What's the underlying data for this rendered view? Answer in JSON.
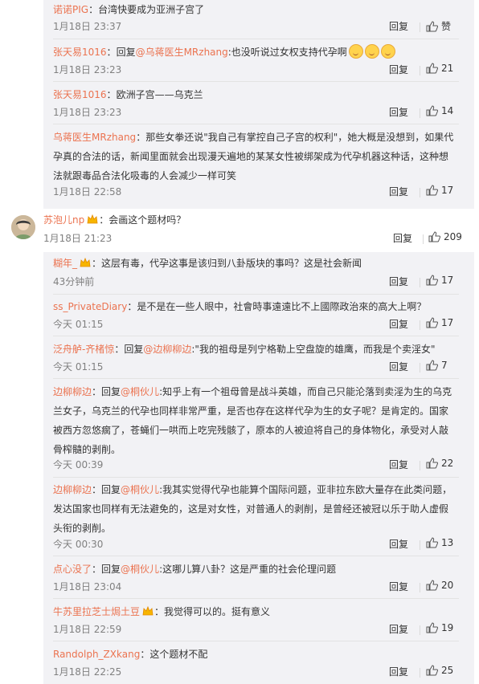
{
  "reply_label": "回复",
  "reply_to_prefix": "回复",
  "colon": ":",
  "comments_upper": [
    {
      "user": "诺诺PIG",
      "sep": "：",
      "text": "台湾快要成为亚洲子宫了",
      "time": "1月18日 23:37",
      "likes": "赞"
    },
    {
      "user": "张天易1016",
      "mention": "@乌蒋医生MRzhang",
      "text": ":也没听说过女权支持代孕啊",
      "time": "1月18日 23:23",
      "likes": "21"
    },
    {
      "user": "张天易1016",
      "sep": "：",
      "text": "欧洲子宫——乌克兰",
      "time": "1月18日 23:23",
      "likes": "14"
    },
    {
      "user": "乌蒋医生MRzhang",
      "sep": "：",
      "text_lines": [
        "那些女拳还说\"我自己有掌控自己子宫的权利\"，她大概是没想到，如果代",
        "孕真的合法的话，新闻里面就会出现漫天遍地的某某女性被绑架成为代孕机器这种话，这种想",
        "法就跟毒品合法化吸毒的人会减少一样可笑"
      ],
      "time": "1月18日 22:58",
      "likes": "17"
    }
  ],
  "main_comment": {
    "user": "苏泡儿np",
    "sep": "：",
    "text": "会画这个题材吗？",
    "time": "1月18日 21:23",
    "likes": "209"
  },
  "comments_lower": [
    {
      "user": "糊年_",
      "sep": "：",
      "text": "这层有毒，代孕这事是该归到八卦版块的事吗？这是社会新闻",
      "time": "43分钟前",
      "likes": "17"
    },
    {
      "user": "ss_PrivateDiary",
      "sep": "：",
      "text": "是不是在一些人眼中，社會時事遠遠比不上國際政治來的高大上啊？",
      "time": "今天 01:15",
      "likes": "17"
    },
    {
      "user": "泛舟舻-齐楮惊",
      "mention": "@边柳柳边",
      "text": ":\"我的祖母是列宁格勒上空盘旋的雄鹰，而我是个卖淫女\"",
      "time": "今天 01:15",
      "likes": "7"
    },
    {
      "user": "边柳柳边",
      "mention": "@桐伙儿",
      "text_lines": [
        ":知乎上有一个祖母曾是战斗英雄，而自己只能沦落到卖淫为生的乌克",
        "兰女子，乌克兰的代孕也同样非常严重，是否也存在这样代孕为生的女子呢？是肯定的。国家",
        "被西方忽悠瘸了，苍蝇们一哄而上吃完残骸了，原本的人被迫将自己的身体物化，承受对人敲",
        "骨榨髓的剥削。"
      ],
      "time": "今天 00:39",
      "likes": "22"
    },
    {
      "user": "边柳柳边",
      "mention": "@桐伙儿",
      "text_lines": [
        ":我其实觉得代孕也能算个国际问题，亚非拉东欧大量存在此类问题，",
        "发达国家也同样有无法避免的，这是对女性，对普通人的剥削，是曾经还被冠以乐于助人虚假",
        "头衔的剥削。"
      ],
      "time": "今天 00:30",
      "likes": "13"
    },
    {
      "user": "点心没了",
      "mention": "@桐伙儿",
      "text": ":这哪儿算八卦？这是严重的社会伦理问题",
      "time": "1月18日 23:04",
      "likes": "20"
    },
    {
      "user": "牛苏里拉芝士焗土豆",
      "sep": "：",
      "text": "我觉得可以的。挺有意义",
      "time": "1月18日 22:59",
      "likes": "19"
    },
    {
      "user": "Randolph_ZXkang",
      "sep": "：",
      "text": "这个题材不配",
      "time": "1月18日 22:25",
      "likes": "25"
    }
  ],
  "colors": {
    "username": "#eb7350",
    "panel_bg": "#f2f2f5",
    "meta": "#808080"
  },
  "icons": [
    "thumbs-up-icon",
    "vip-badge-icon",
    "emoji-icon"
  ]
}
